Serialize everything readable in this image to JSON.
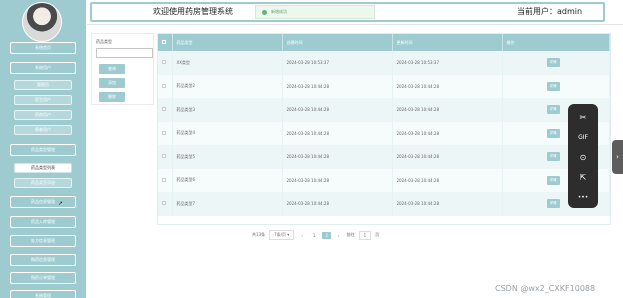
{
  "header": {
    "title": "欢迎使用药房管理系统",
    "user_label": "当前用户：admin"
  },
  "toast": {
    "text": "新增成功"
  },
  "sidebar": {
    "items": [
      {
        "label": "系统首页"
      },
      {
        "label": "系统用户"
      },
      {
        "label": "管理员"
      },
      {
        "label": "医生用户"
      },
      {
        "label": "药房用户"
      },
      {
        "label": "患者用户"
      },
      {
        "label": "药品类型管理"
      },
      {
        "label": "药品类型列表"
      },
      {
        "label": "药品类型添加"
      },
      {
        "label": "药品信息管理"
      },
      {
        "label": "药品入库管理"
      },
      {
        "label": "处方信息管理"
      },
      {
        "label": "购药信息管理"
      },
      {
        "label": "购药订单管理"
      },
      {
        "label": "系统管理"
      }
    ]
  },
  "filter": {
    "label": "药品类型",
    "search_btn": "查询",
    "add_btn": "添加",
    "delete_btn": "删除"
  },
  "table": {
    "headers": [
      "药品类型",
      "创建时间",
      "更新时间",
      "操作"
    ],
    "rows": [
      {
        "type": "XX类型",
        "created": "2024-03-28 10:53:37",
        "updated": "2024-03-28 10:53:37",
        "action": "详情"
      },
      {
        "type": "药品类型2",
        "created": "2024-03-28 10:44:28",
        "updated": "2024-03-28 10:44:28",
        "action": "详情"
      },
      {
        "type": "药品类型3",
        "created": "2024-03-28 10:44:28",
        "updated": "2024-03-28 10:44:28",
        "action": "详情"
      },
      {
        "type": "药品类型4",
        "created": "2024-03-28 10:44:28",
        "updated": "2024-03-28 10:44:28",
        "action": "详情"
      },
      {
        "type": "药品类型5",
        "created": "2024-03-28 10:44:28",
        "updated": "2024-03-28 10:44:28",
        "action": "详情"
      },
      {
        "type": "药品类型6",
        "created": "2024-03-28 10:44:28",
        "updated": "2024-03-28 10:44:28",
        "action": "详情"
      },
      {
        "type": "药品类型7",
        "created": "2024-03-28 10:44:28",
        "updated": "2024-03-28 10:44:28",
        "action": "详情"
      }
    ]
  },
  "pagination": {
    "total": "共13条",
    "page_size": "7条/页",
    "prev": "‹",
    "page1": "1",
    "page2": "2",
    "next": "›",
    "goto_label": "前往",
    "goto_value": "1",
    "page_suffix": "页"
  },
  "floating_toolbar": {
    "tools": [
      {
        "icon": "scissors-icon",
        "glyph": "✂"
      },
      {
        "icon": "gif-icon",
        "glyph": "GIF"
      },
      {
        "icon": "search-icon",
        "glyph": "⊙"
      },
      {
        "icon": "share-icon",
        "glyph": "⇱"
      },
      {
        "icon": "more-icon",
        "glyph": "•••"
      }
    ]
  },
  "side_tab": {
    "glyph": "›"
  },
  "watermark": "CSDN @wx2_CXKF10088"
}
